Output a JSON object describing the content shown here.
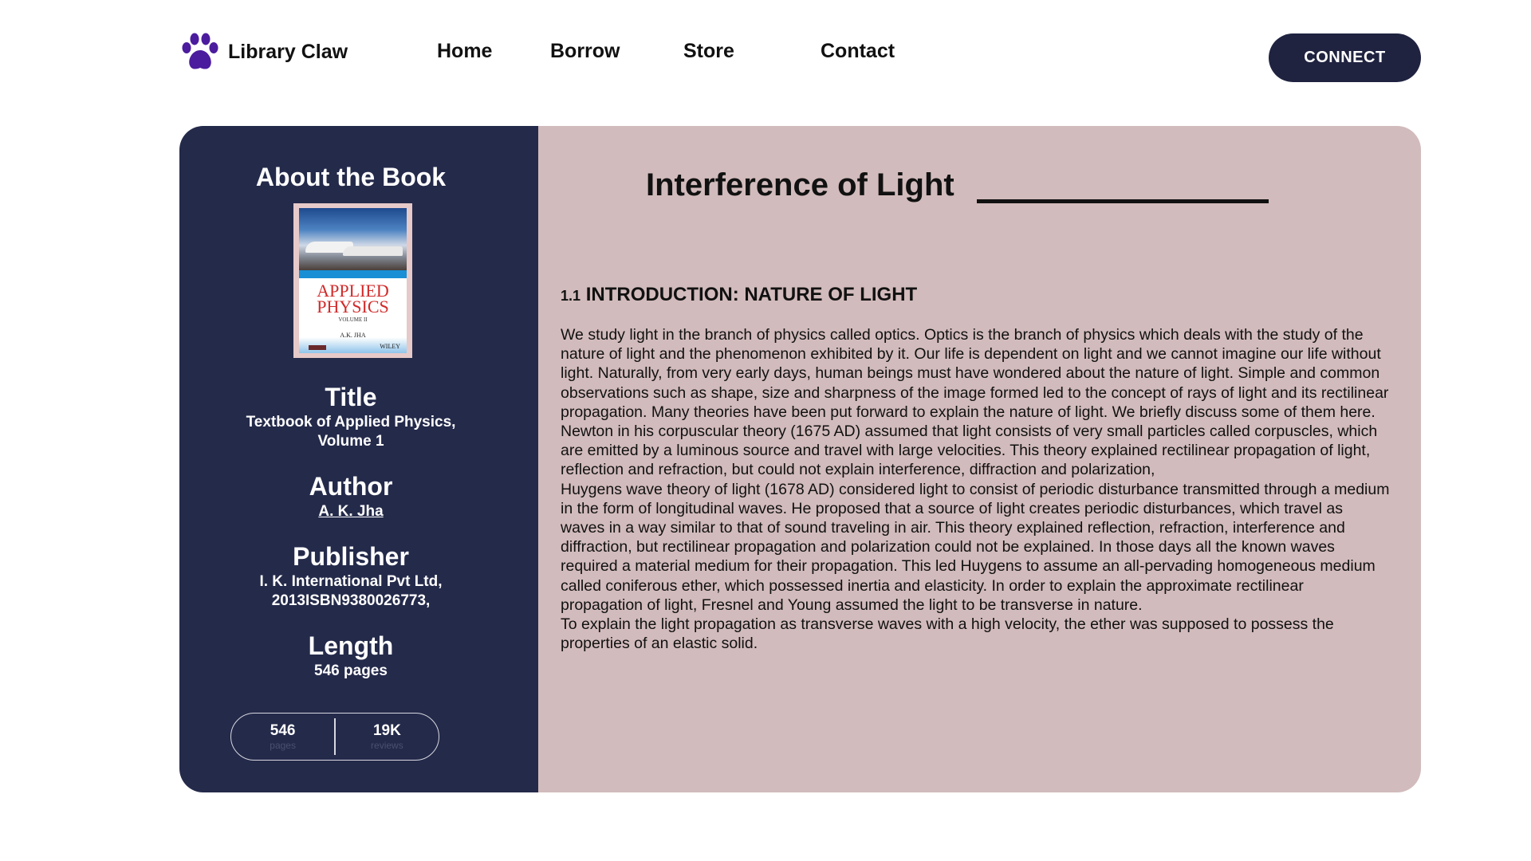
{
  "header": {
    "brand_name": "Library Claw",
    "brand_icon": "paw-icon",
    "brand_color": "#4b1c9e",
    "nav": [
      {
        "label": "Home"
      },
      {
        "label": "Borrow"
      },
      {
        "label": "Store"
      },
      {
        "label": "Contact"
      }
    ],
    "connect_label": "CONNECT"
  },
  "sidebar": {
    "heading": "About the Book",
    "cover": {
      "title": "APPLIED PHYSICS",
      "volume": "VOLUME II",
      "author": "A.K. JHA",
      "publisher_mark": "WILEY"
    },
    "title_label": "Title",
    "title_value": "Textbook of Applied Physics, Volume 1",
    "author_label": "Author",
    "author_value": "A. K. Jha",
    "publisher_label": "Publisher",
    "publisher_line1": "I. K. International Pvt Ltd,",
    "publisher_line2": "2013ISBN9380026773,",
    "length_label": "Length",
    "length_value": "546 pages",
    "stats": [
      {
        "value": "546",
        "caption": "pages"
      },
      {
        "value": "19K",
        "caption": "reviews"
      }
    ]
  },
  "article": {
    "title": "Interference of Light",
    "section_number": "1.1",
    "section_title": "INTRODUCTION: NATURE OF LIGHT",
    "paragraphs": [
      "We study light in the branch of physics called optics. Optics is the branch of physics which deals with the study of the nature of light and the phenomenon exhibited by it. Our life is dependent on light and we cannot imagine our life without light. Naturally, from very early days, human beings must have wondered about the nature of light. Simple and common observations such as shape, size and sharpness of the image formed led to the concept of rays of light and its rectilinear propagation. Many theories have been put forward to explain the nature of light. We briefly discuss some of them here.",
      "Newton in his corpuscular theory (1675 AD) assumed that light consists of very small particles called corpuscles, which are emitted by a luminous source and travel with large velocities. This theory explained rectilinear propagation of light, reflection and refraction, but could not explain interference, diffraction and polarization,",
      "Huygens wave theory of light (1678 AD) considered light to consist of periodic disturbance transmitted through a medium in the form of longitudinal waves. He proposed that a source of light creates periodic disturbances, which travel as waves in a way similar to that of sound traveling in air. This theory explained reflection, refraction, interference and diffraction, but rectilinear propagation and polarization could not be explained. In those days all the known waves required a material medium for their propagation. This led Huygens to assume an all-pervading homogeneous medium called coniferous ether, which possessed inertia and elasticity. In order to explain the approximate rectilinear propagation of light, Fresnel and Young assumed the light to be transverse in nature.",
      "To explain the light propagation as transverse waves with a high velocity, the ether was supposed to possess the properties of an elastic solid."
    ]
  },
  "colors": {
    "sidebar_bg": "#242a4a",
    "content_bg": "#d2bbbc",
    "button_bg": "#1f2340"
  }
}
